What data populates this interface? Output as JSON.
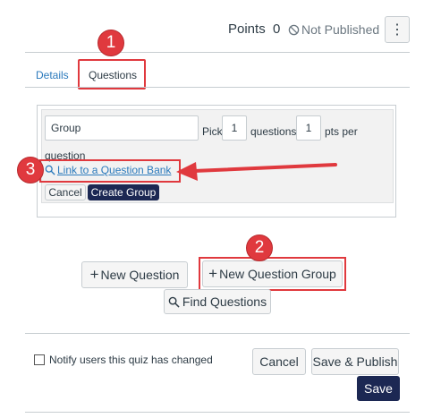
{
  "header": {
    "points_label": "Points",
    "points_value": "0",
    "status_label": "Not Published",
    "menu_icon": "kebab-menu-icon"
  },
  "tabs": [
    {
      "label": "Details"
    },
    {
      "label": "Questions"
    }
  ],
  "annotations": {
    "badge_1": "1",
    "badge_2": "2",
    "badge_3": "3",
    "highlight_color": "#e0393e"
  },
  "group_editor": {
    "group_name_value": "Group",
    "pick_label": "Pick",
    "pick_value": "1",
    "questions_label": "questions,",
    "pts_value": "1",
    "pts_per_label": "pts per",
    "question_label": "question",
    "link_bank_label": "Link to a Question Bank",
    "cancel_label": "Cancel",
    "create_group_label": "Create Group"
  },
  "actions": {
    "new_question_label": "New Question",
    "new_question_group_label": "New Question Group",
    "find_questions_label": "Find Questions"
  },
  "footer": {
    "notify_label": "Notify users this quiz has changed",
    "cancel_label": "Cancel",
    "save_publish_label": "Save & Publish",
    "save_label": "Save"
  },
  "colors": {
    "primary": "#1c2853",
    "link": "#2b7abc",
    "annotation": "#e0393e"
  }
}
